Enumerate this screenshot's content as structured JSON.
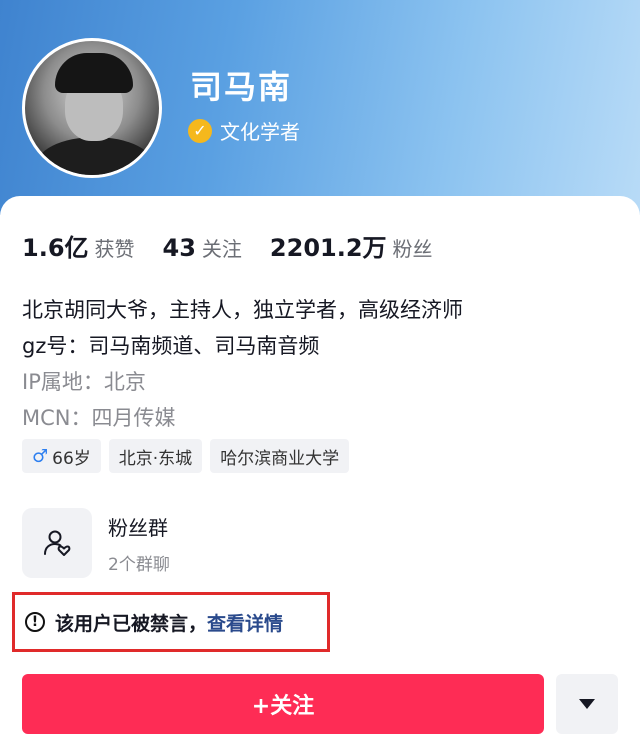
{
  "profile": {
    "name": "司马南",
    "verification": "文化学者"
  },
  "stats": [
    {
      "value": "1.6亿",
      "label": "获赞"
    },
    {
      "value": "43",
      "label": "关注"
    },
    {
      "value": "2201.2万",
      "label": "粉丝"
    }
  ],
  "bio": {
    "line1": "北京胡同大爷，主持人，独立学者，高级经济师",
    "line2": "gz号：司马南频道、司马南音频",
    "ip": "IP属地：北京",
    "mcn": "MCN：四月传媒"
  },
  "tags": {
    "gender_symbol": "♂",
    "age": "66岁",
    "location": "北京·东城",
    "school": "哈尔滨商业大学"
  },
  "fan_group": {
    "title": "粉丝群",
    "subtitle": "2个群聊"
  },
  "banned_notice": {
    "icon": "!",
    "text": "该用户已被禁言，",
    "link": "查看详情"
  },
  "actions": {
    "follow_label": "+关注"
  },
  "colors": {
    "follow_button": "#fe2c55",
    "verify_badge": "#f5b81d",
    "highlight_border": "#e02a2a"
  }
}
